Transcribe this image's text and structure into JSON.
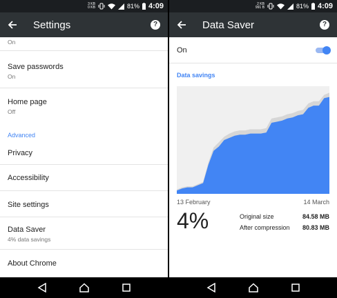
{
  "status_bar": {
    "net_up": "3 KB",
    "net_down": "0 KB",
    "net_up_right": "2 KB",
    "net_down_right": "991 B",
    "battery": "81%",
    "time": "4:09"
  },
  "left": {
    "app_bar": {
      "title": "Settings"
    },
    "items": [
      {
        "sub": "On"
      },
      {
        "title": "Save passwords",
        "sub": "On"
      },
      {
        "title": "Home page",
        "sub": "Off"
      },
      {
        "title": "Privacy"
      },
      {
        "title": "Accessibility"
      },
      {
        "title": "Site settings"
      },
      {
        "title": "Data Saver",
        "sub": "4% data savings"
      },
      {
        "title": "About Chrome"
      }
    ],
    "section_advanced": "Advanced"
  },
  "right": {
    "app_bar": {
      "title": "Data Saver"
    },
    "toggle": {
      "label": "On",
      "state": true
    },
    "section_title": "Data savings",
    "date_start": "13 February",
    "date_end": "14 March",
    "savings_percent": "4%",
    "original_label": "Original size",
    "original_value": "84.58 MB",
    "compressed_label": "After compression",
    "compressed_value": "80.83 MB"
  },
  "colors": {
    "accent": "#4285f4",
    "appbar": "#2e3336",
    "statusbar": "#1b1e21"
  },
  "chart_data": {
    "type": "area",
    "xlabel": "",
    "ylabel": "",
    "x": [
      0,
      1,
      2,
      3,
      4,
      5,
      6,
      7,
      8,
      9,
      10,
      11,
      12,
      13,
      14,
      15,
      16,
      17,
      18,
      19,
      20,
      21,
      22,
      23,
      24,
      25,
      26,
      27,
      28,
      29
    ],
    "ylim": [
      0,
      100
    ],
    "series": [
      {
        "values": [
          3,
          5,
          6,
          6,
          8,
          10,
          27,
          40,
          44,
          50,
          52,
          54,
          55,
          55,
          56,
          56,
          56,
          57,
          66,
          67,
          68,
          70,
          71,
          73,
          74,
          80,
          82,
          82,
          89,
          90
        ]
      },
      {
        "values": [
          4,
          6,
          7,
          7,
          9,
          11,
          29,
          43,
          48,
          53,
          56,
          58,
          59,
          59,
          60,
          60,
          60,
          61,
          70,
          71,
          72,
          74,
          75,
          77,
          78,
          84,
          86,
          86,
          92,
          94
        ]
      }
    ]
  }
}
